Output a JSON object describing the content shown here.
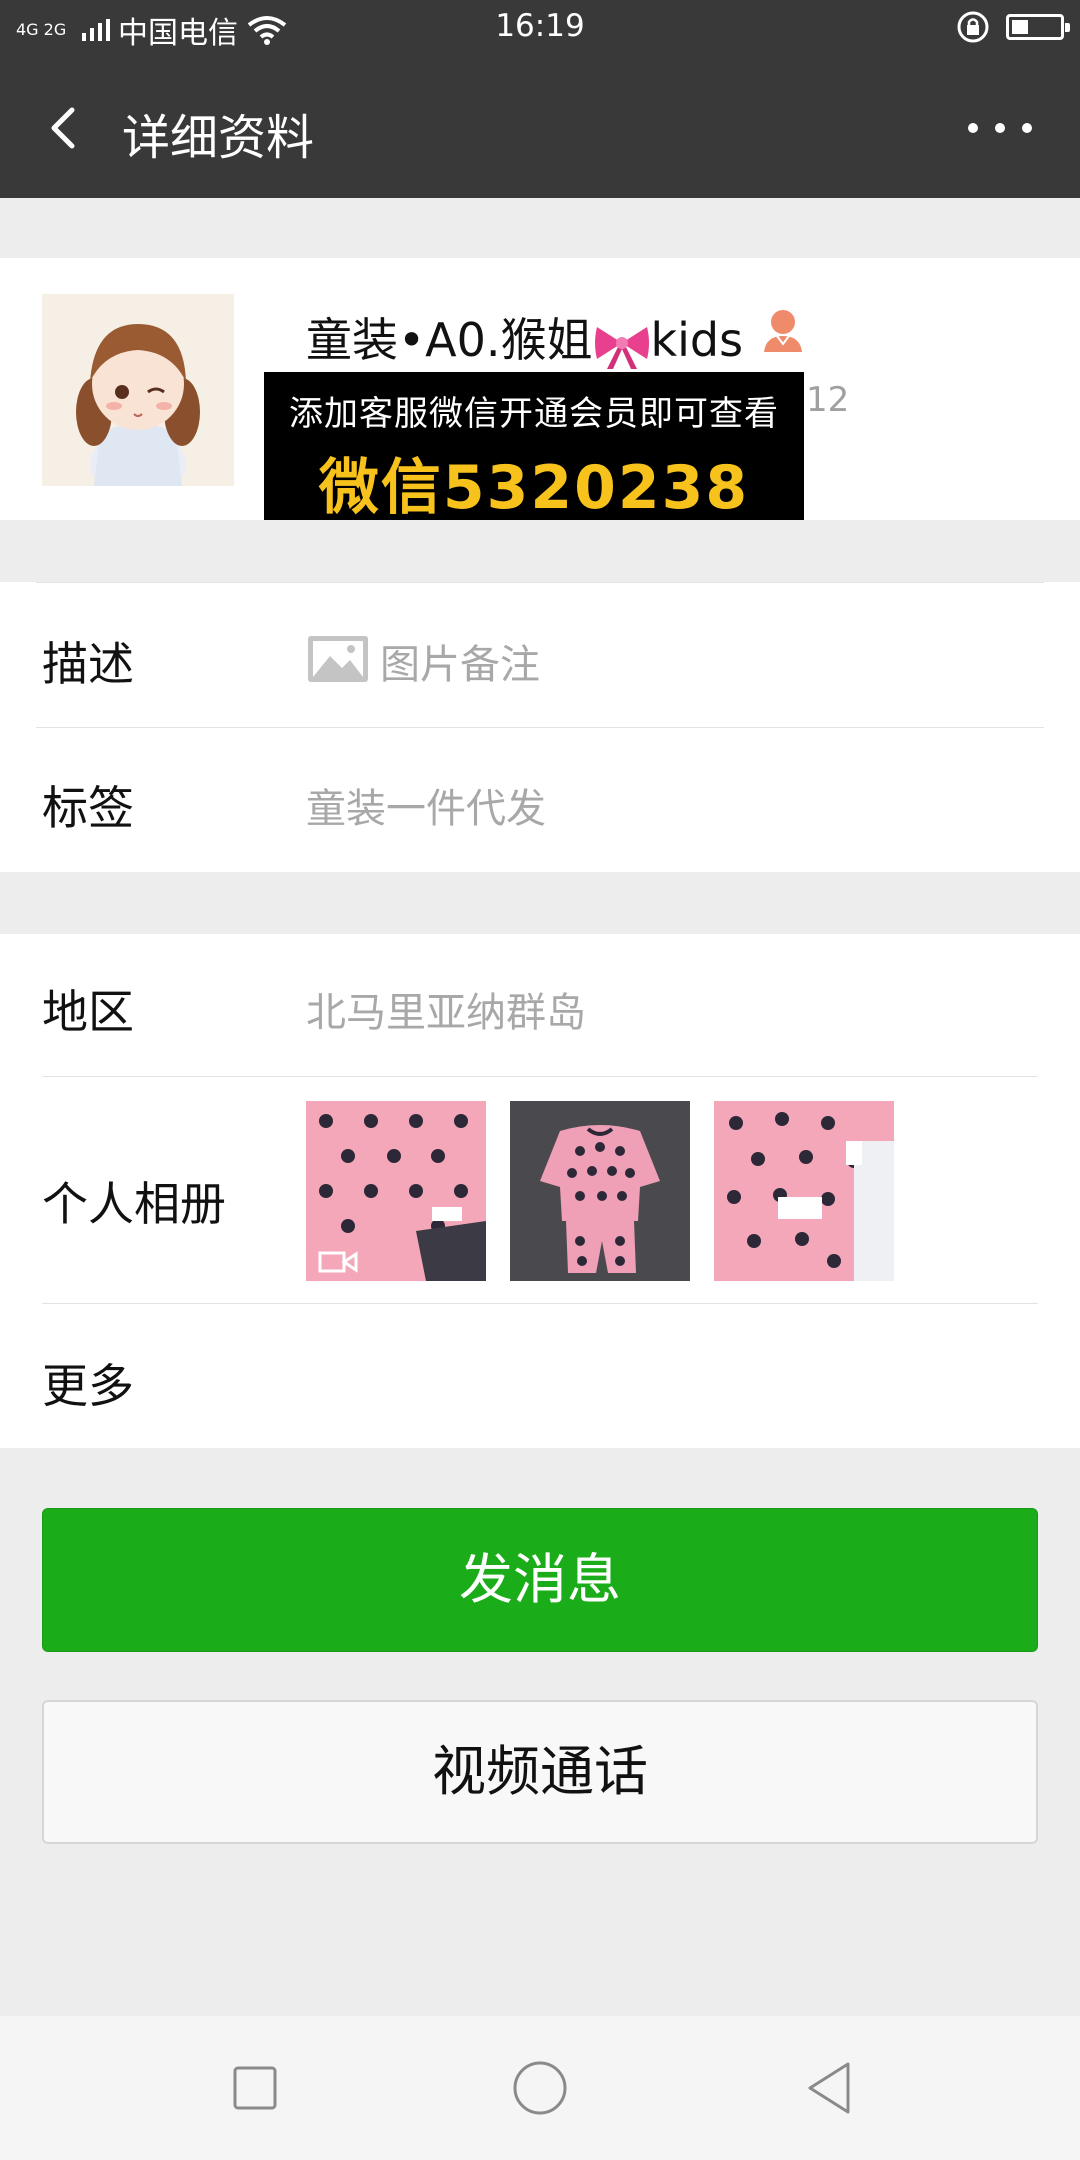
{
  "status_bar": {
    "network": "4G 2G",
    "carrier": "中国电信",
    "time": "16:19",
    "battery_level": 0.35
  },
  "nav": {
    "title": "详细资料"
  },
  "profile": {
    "name_prefix": "童装•A0.猴姐",
    "name_suffix": "kids",
    "ad_line1": "添加客服微信开通会员即可查看",
    "ad_line2": "微信5320238",
    "wechat_id_tail": "12"
  },
  "rows": {
    "description": {
      "label": "描述",
      "value": "图片备注"
    },
    "tags": {
      "label": "标签",
      "value": "童装一件代发"
    },
    "region": {
      "label": "地区",
      "value": "北马里亚纳群岛"
    },
    "album": {
      "label": "个人相册"
    },
    "more": {
      "label": "更多"
    }
  },
  "buttons": {
    "send_message": "发消息",
    "video_call": "视频通话"
  },
  "colors": {
    "header_bg": "#393939",
    "primary_green": "#1aad19",
    "page_bg": "#ededed",
    "ad_yellow": "#f7c21c"
  }
}
